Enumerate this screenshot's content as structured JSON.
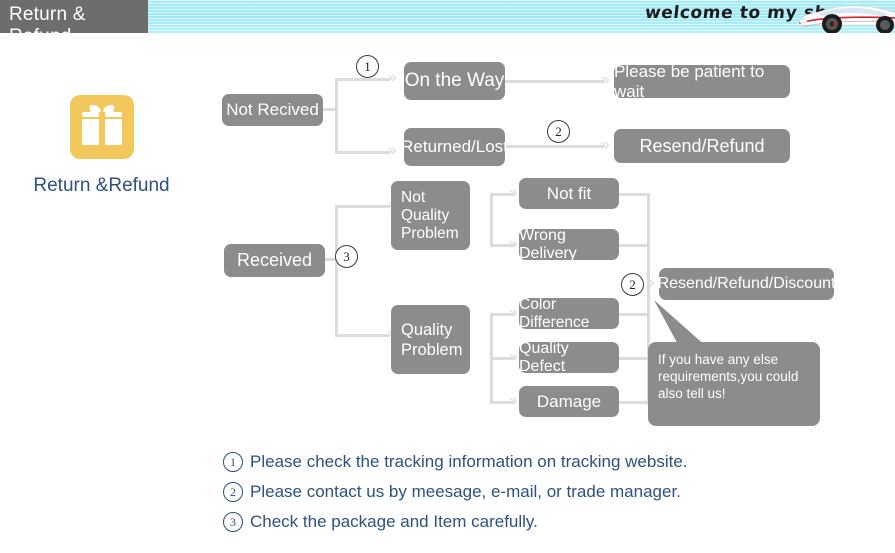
{
  "banner": {
    "tab_title": "Return & Refund",
    "welcome_text": "welcome to my shop",
    "car_icon": "sports-car-image",
    "stripe_color": "#a9ecf7",
    "tab_color": "#6d6d6d"
  },
  "gift": {
    "icon": "gift-box-icon",
    "icon_color": "#f2c75c",
    "label": "Return &Refund"
  },
  "flow": {
    "box_color": "#8c8c8c",
    "line_color": "#dcdcdc",
    "nodes": [
      {
        "id": "not-received",
        "label": "Not Recived"
      },
      {
        "id": "on-the-way",
        "label": "On the Way"
      },
      {
        "id": "returned-lost",
        "label": "Returned/Lost"
      },
      {
        "id": "please-be-patient",
        "label": "Please be patient to wait"
      },
      {
        "id": "resend-refund",
        "label": "Resend/Refund"
      },
      {
        "id": "received",
        "label": "Received"
      },
      {
        "id": "not-quality-problem",
        "label": "Not\nQuality\nProblem"
      },
      {
        "id": "quality-problem",
        "label": "Quality\nProblem"
      },
      {
        "id": "not-fit",
        "label": "Not fit"
      },
      {
        "id": "wrong-delivery",
        "label": "Wrong Delivery"
      },
      {
        "id": "color-difference",
        "label": "Color Difference"
      },
      {
        "id": "quality-defect",
        "label": "Quality Defect"
      },
      {
        "id": "damage",
        "label": "Damage"
      },
      {
        "id": "resend-refund-discount",
        "label": "Resend/Refund/Discount"
      }
    ],
    "markers": {
      "m1": "1",
      "m2_top": "2",
      "m3": "3",
      "m2_bottom": "2"
    },
    "bubble": {
      "text": "If you have any else requirements,you could also tell us!",
      "line1": "If you have any else",
      "line2": "requirements,you could",
      "line3": "also tell us!"
    }
  },
  "legend": {
    "text_color": "#2d5182",
    "items": [
      {
        "num": "1",
        "text": "Please check the tracking information on tracking website."
      },
      {
        "num": "2",
        "text": "Please contact us by meesage, e-mail, or trade manager."
      },
      {
        "num": "3",
        "text": "Check the package and Item carefully."
      }
    ]
  }
}
